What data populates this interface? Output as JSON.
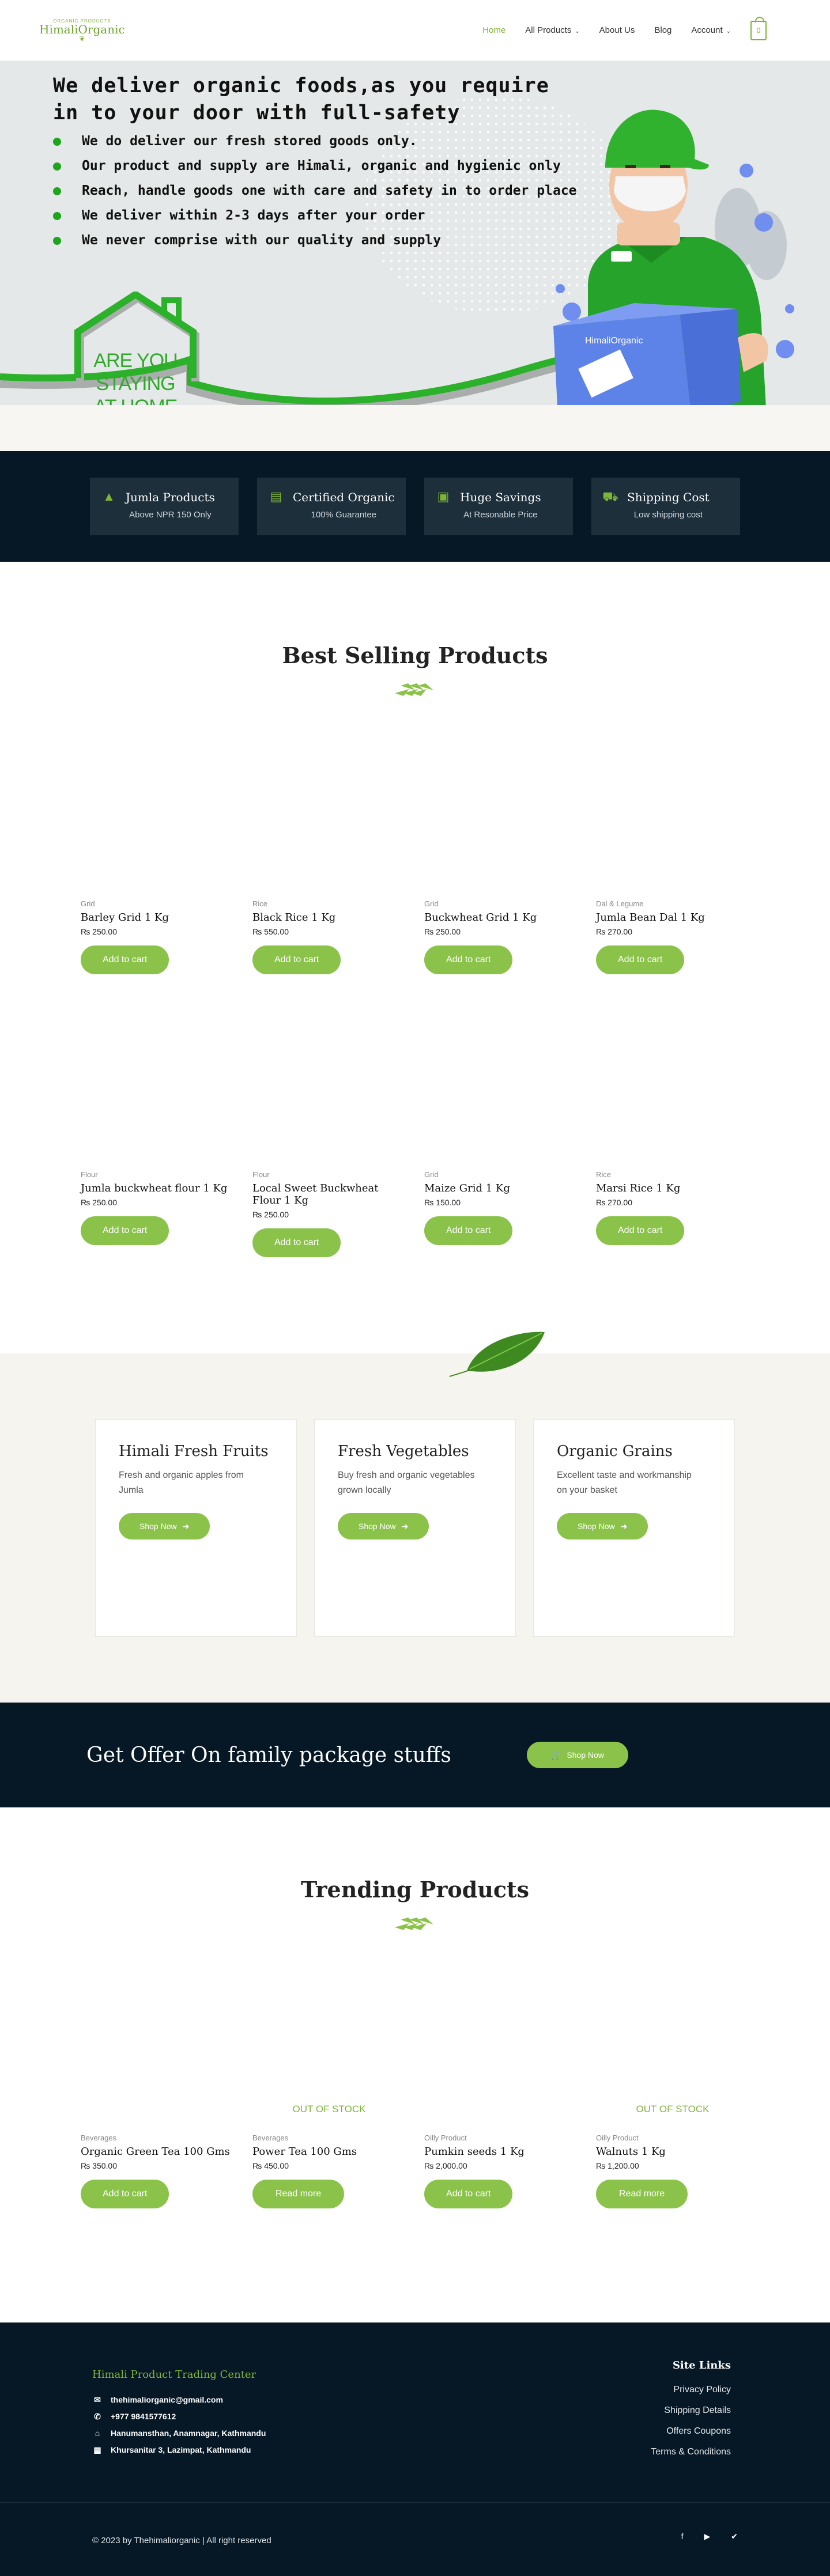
{
  "header": {
    "logo_small": "ORGANIC PRODUCTS",
    "logo_big": "HimaliOrganic",
    "nav": [
      {
        "label": "Home"
      },
      {
        "label": "All Products"
      },
      {
        "label": "About Us"
      },
      {
        "label": "Blog"
      },
      {
        "label": "Account"
      }
    ],
    "cart_count": "0"
  },
  "hero": {
    "heading": "We deliver organic foods,as you require in to your door with full-safety",
    "bullets": [
      "We do deliver our fresh stored goods only.",
      "Our product and supply are Himali, organic and  hygienic only",
      "Reach, handle goods one with care and safety in to order place",
      "We deliver within 2-3 days after your order",
      "We never comprise with our quality and supply"
    ],
    "home_text": [
      "ARE YOU",
      "STAYING",
      "AT HOME"
    ],
    "box_label": "HimaliOrganic"
  },
  "features": [
    {
      "icon": "mountain-icon",
      "title": "Jumla Products",
      "sub": "Above NPR 150 Only"
    },
    {
      "icon": "certificate-icon",
      "title": "Certified Organic",
      "sub": "100% Guarantee"
    },
    {
      "icon": "money-icon",
      "title": "Huge Savings",
      "sub": "At Resonable Price"
    },
    {
      "icon": "truck-icon",
      "title": "Shipping Cost",
      "sub": "Low shipping cost"
    }
  ],
  "best_selling": {
    "title": "Best Selling Products",
    "products": [
      {
        "category": "Grid",
        "name": "Barley Grid 1 Kg",
        "price": "₨ 250.00",
        "button": "Add to cart",
        "oos": ""
      },
      {
        "category": "Rice",
        "name": "Black Rice 1 Kg",
        "price": "₨ 550.00",
        "button": "Add to cart",
        "oos": ""
      },
      {
        "category": "Grid",
        "name": "Buckwheat Grid 1 Kg",
        "price": "₨ 250.00",
        "button": "Add to cart",
        "oos": ""
      },
      {
        "category": "Dal & Legume",
        "name": "Jumla Bean Dal 1 Kg",
        "price": "₨ 270.00",
        "button": "Add to cart",
        "oos": ""
      },
      {
        "category": "Flour",
        "name": "Jumla buckwheat flour 1 Kg",
        "price": "₨ 250.00",
        "button": "Add to cart",
        "oos": ""
      },
      {
        "category": "Flour",
        "name": "Local Sweet Buckwheat Flour 1 Kg",
        "price": "₨ 250.00",
        "button": "Add to cart",
        "oos": ""
      },
      {
        "category": "Grid",
        "name": "Maize Grid 1 Kg",
        "price": "₨ 150.00",
        "button": "Add to cart",
        "oos": ""
      },
      {
        "category": "Rice",
        "name": "Marsi Rice 1 Kg",
        "price": "₨ 270.00",
        "button": "Add to cart",
        "oos": ""
      }
    ]
  },
  "categories": [
    {
      "title": "Himali Fresh Fruits",
      "desc": "Fresh and organic apples from Jumla",
      "button": "Shop Now"
    },
    {
      "title": "Fresh Vegetables",
      "desc": "Buy fresh and organic vegetables grown locally",
      "button": "Shop Now"
    },
    {
      "title": "Organic Grains",
      "desc": "Excellent taste and workmanship on your basket",
      "button": "Shop Now"
    }
  ],
  "offer": {
    "title": "Get Offer On family package stuffs",
    "button": "Shop Now"
  },
  "trending": {
    "title": "Trending Products",
    "products": [
      {
        "category": "Beverages",
        "name": "Organic Green Tea 100 Gms",
        "price": "₨ 350.00",
        "button": "Add to cart",
        "oos": ""
      },
      {
        "category": "Beverages",
        "name": "Power Tea 100 Gms",
        "price": "₨ 450.00",
        "button": "Read more",
        "oos": "OUT OF STOCK"
      },
      {
        "category": "Oilly Product",
        "name": "Pumkin seeds 1 Kg",
        "price": "₨ 2,000.00",
        "button": "Add to cart",
        "oos": ""
      },
      {
        "category": "Oilly Product",
        "name": "Walnuts 1 Kg",
        "price": "₨ 1,200.00",
        "button": "Read more",
        "oos": "OUT OF STOCK"
      }
    ]
  },
  "footer": {
    "title": "Himali Product Trading Center",
    "contacts": [
      {
        "icon": "email-icon",
        "text": "thehimaliorganic@gmail.com"
      },
      {
        "icon": "phone-icon",
        "text": "+977 9841577612"
      },
      {
        "icon": "store-icon",
        "text": "Hanumansthan, Anamnagar, Kathmandu"
      },
      {
        "icon": "building-icon",
        "text": "Khursanitar 3, Lazimpat, Kathmandu"
      }
    ],
    "links_title": "Site Links",
    "links": [
      "Privacy Policy",
      "Shipping Details",
      "Offers Coupons",
      "Terms & Conditions"
    ],
    "copyright": "© 2023 by Thehimaliorganic | All right reserved",
    "social": [
      {
        "icon": "facebook-icon",
        "glyph": "f"
      },
      {
        "icon": "youtube-icon",
        "glyph": "▶"
      },
      {
        "icon": "twitter-icon",
        "glyph": "✔"
      }
    ]
  }
}
